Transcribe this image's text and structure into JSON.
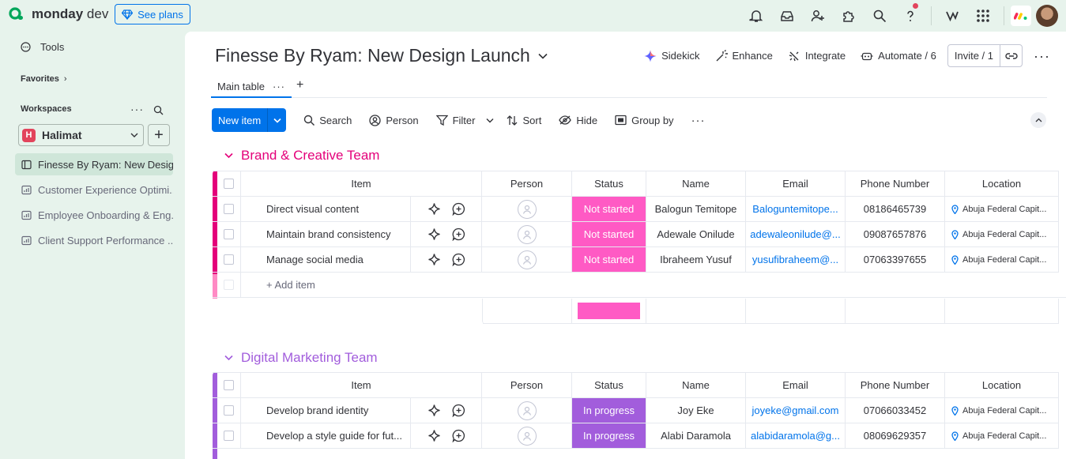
{
  "app": {
    "brand": "monday",
    "brand_suffix": " dev",
    "see_plans": "See plans"
  },
  "top_icons": [
    "bell-icon",
    "inbox-icon",
    "invite-members-icon",
    "apps-icon",
    "search-icon",
    "help-icon",
    "vibe-icon",
    "grid-icon"
  ],
  "sidebar": {
    "tools": "Tools",
    "favorites": "Favorites",
    "workspaces": "Workspaces",
    "workspace_badge": "H",
    "workspace_name": "Halimat",
    "boards": [
      {
        "label": "Finesse By Ryam: New Desig..."
      },
      {
        "label": "Customer Experience Optimi..."
      },
      {
        "label": "Employee Onboarding & Eng..."
      },
      {
        "label": "Client Support Performance ..."
      }
    ]
  },
  "board": {
    "title": "Finesse By Ryam: New Design Launch",
    "actions": {
      "sidekick": "Sidekick",
      "enhance": "Enhance",
      "integrate": "Integrate",
      "automate": "Automate / 6",
      "invite": "Invite / 1"
    },
    "tab": "Main table",
    "toolbar": {
      "new_item": "New item",
      "search": "Search",
      "person": "Person",
      "filter": "Filter",
      "sort": "Sort",
      "hide": "Hide",
      "group_by": "Group by"
    }
  },
  "columns": {
    "item": "Item",
    "person": "Person",
    "status": "Status",
    "name": "Name",
    "email": "Email",
    "phone": "Phone Number",
    "location": "Location"
  },
  "groups": [
    {
      "title": "Brand & Creative Team",
      "color": "#e2445c",
      "title_color": "#e4007a",
      "add_item": "+ Add item",
      "rows": [
        {
          "item": "Direct visual content",
          "status": "Not started",
          "name": "Balogun Temitope",
          "email": "Baloguntemitope...",
          "phone": "08186465739",
          "location": "Abuja Federal Capit..."
        },
        {
          "item": "Maintain brand consistency",
          "status": "Not started",
          "name": "Adewale Onilude",
          "email": "adewaleonilude@...",
          "phone": "09087657876",
          "location": "Abuja Federal Capit..."
        },
        {
          "item": "Manage social media",
          "status": "Not started",
          "name": "Ibraheem Yusuf",
          "email": "yusufibraheem@...",
          "phone": "07063397655",
          "location": "Abuja Federal Capit..."
        }
      ]
    },
    {
      "title": "Digital Marketing Team",
      "color": "#a25ddc",
      "title_color": "#a25ddc",
      "rows": [
        {
          "item": "Develop brand identity",
          "status": "In progress",
          "name": "Joy Eke",
          "email": "joyeke@gmail.com",
          "phone": "07066033452",
          "location": "Abuja Federal Capit..."
        },
        {
          "item": "Develop a style guide for fut...",
          "status": "In progress",
          "name": "Alabi Daramola",
          "email": "alabidaramola@g...",
          "phone": "08069629357",
          "location": "Abuja Federal Capit..."
        }
      ]
    }
  ],
  "colors": {
    "not_started": "#ff5ac4",
    "in_progress": "#a25ddc",
    "accent": "#0073ea"
  }
}
